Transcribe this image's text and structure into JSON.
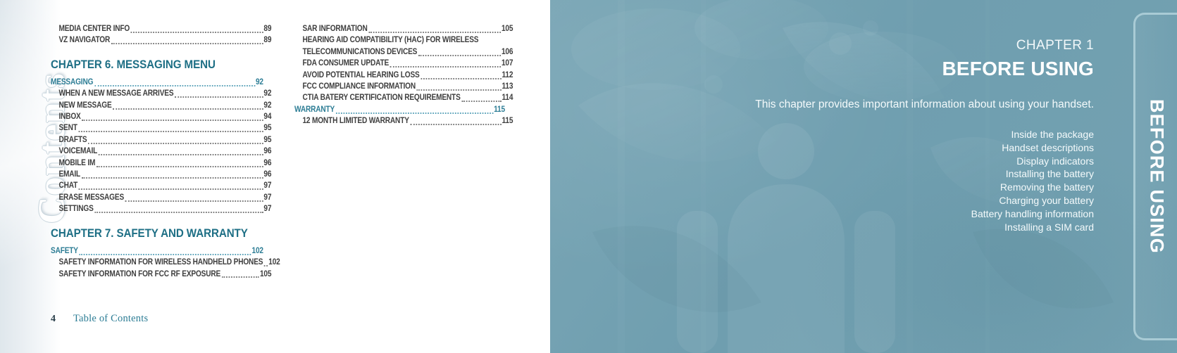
{
  "colors": {
    "teal_accent": "#2d7d95",
    "chapter_heading": "#1e6f85",
    "page_bg_right": "#74a1b1",
    "body_text": "#3e3e3e",
    "tab_border": "#a9cbd5"
  },
  "left_page": {
    "watermark": "Contents",
    "footer": {
      "page_number": "4",
      "label": "Table of Contents"
    },
    "columns": [
      {
        "name": "column-left",
        "blocks": [
          {
            "type": "entries",
            "items": [
              {
                "label": "MEDIA CENTER INFO",
                "page": "89",
                "level": 2,
                "teal": false
              },
              {
                "label": "VZ NAVIGATOR",
                "page": "89",
                "level": 2,
                "teal": false
              }
            ]
          },
          {
            "type": "chapter",
            "title": "CHAPTER 6. MESSAGING MENU"
          },
          {
            "type": "entries",
            "items": [
              {
                "label": "MESSAGING",
                "page": "92",
                "level": 1,
                "teal": true
              },
              {
                "label": "WHEN A NEW MESSAGE ARRIVES",
                "page": "92",
                "level": 2,
                "teal": false
              },
              {
                "label": "NEW MESSAGE",
                "page": "92",
                "level": 2,
                "teal": false
              },
              {
                "label": "INBOX",
                "page": "94",
                "level": 2,
                "teal": false
              },
              {
                "label": "SENT",
                "page": "95",
                "level": 2,
                "teal": false
              },
              {
                "label": "DRAFTS",
                "page": "95",
                "level": 2,
                "teal": false
              },
              {
                "label": "VOICEMAIL",
                "page": "96",
                "level": 2,
                "teal": false
              },
              {
                "label": "MOBILE IM",
                "page": "96",
                "level": 2,
                "teal": false
              },
              {
                "label": "EMAIL",
                "page": "96",
                "level": 2,
                "teal": false
              },
              {
                "label": "CHAT",
                "page": "97",
                "level": 2,
                "teal": false
              },
              {
                "label": "ERASE MESSAGES",
                "page": "97",
                "level": 2,
                "teal": false
              },
              {
                "label": "SETTINGS",
                "page": "97",
                "level": 2,
                "teal": false
              }
            ]
          },
          {
            "type": "chapter",
            "title": "CHAPTER 7. SAFETY AND WARRANTY"
          },
          {
            "type": "entries",
            "items": [
              {
                "label": "SAFETY",
                "page": "102",
                "level": 1,
                "teal": true
              },
              {
                "label": "SAFETY INFORMATION FOR WIRELESS HANDHELD PHONES",
                "page": "102",
                "level": 2,
                "teal": false
              },
              {
                "label": "SAFETY INFORMATION FOR FCC RF EXPOSURE",
                "page": "105",
                "level": 2,
                "teal": false
              }
            ]
          }
        ]
      },
      {
        "name": "column-right",
        "blocks": [
          {
            "type": "entries",
            "items": [
              {
                "label": "SAR INFORMATION",
                "page": "105",
                "level": 2,
                "teal": false
              },
              {
                "label": "HEARING AID COMPATIBILITY (HAC) FOR WIRELESS",
                "page": "",
                "level": 2,
                "teal": false,
                "nodots": true
              },
              {
                "label": "TELECOMMUNICATIONS DEVICES",
                "page": "106",
                "level": 2,
                "teal": false
              },
              {
                "label": "FDA CONSUMER UPDATE",
                "page": "107",
                "level": 2,
                "teal": false
              },
              {
                "label": "AVOID POTENTIAL HEARING LOSS",
                "page": "112",
                "level": 2,
                "teal": false
              },
              {
                "label": "FCC COMPLIANCE INFORMATION",
                "page": "113",
                "level": 2,
                "teal": false
              },
              {
                "label": "CTIA BATERY CERTIFICATION REQUIREMENTS",
                "page": "114",
                "level": 2,
                "teal": false
              },
              {
                "label": "WARRANTY",
                "page": "115",
                "level": 1,
                "teal": true
              },
              {
                "label": "12 MONTH LIMITED WARRANTY",
                "page": "115",
                "level": 2,
                "teal": false
              }
            ]
          }
        ]
      }
    ]
  },
  "right_page": {
    "chapter_number": "CHAPTER 1",
    "chapter_title": "BEFORE USING",
    "description": "This chapter provides important information about using your handset.",
    "topics": [
      "Inside the package",
      "Handset descriptions",
      "Display indicators",
      "Installing the battery",
      "Removing the battery",
      "Charging your battery",
      "Battery handling information",
      "Installing a SIM card"
    ],
    "side_tab_label": "BEFORE USING"
  }
}
